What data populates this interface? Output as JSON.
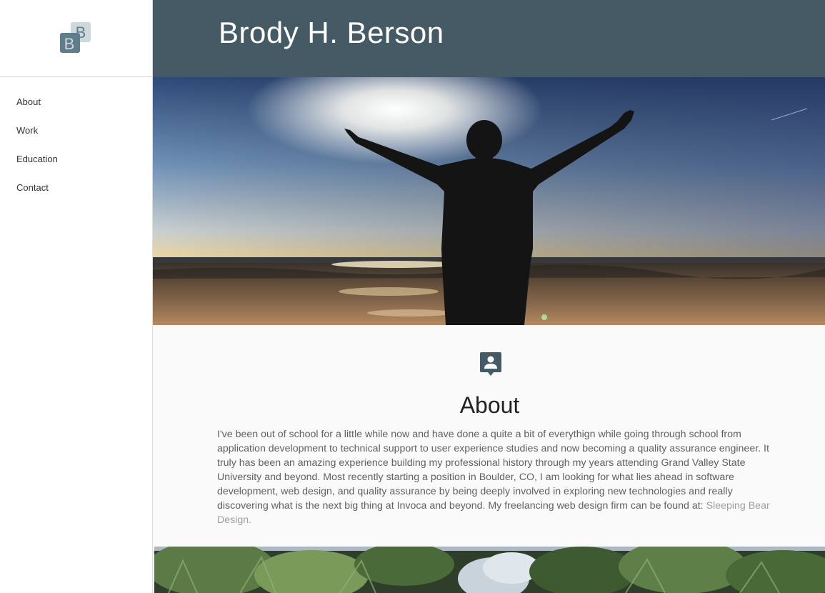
{
  "logo": {
    "letters": [
      "B",
      "B"
    ],
    "icon": "bb-monogram-logo"
  },
  "nav": {
    "items": [
      {
        "label": "About"
      },
      {
        "label": "Work"
      },
      {
        "label": "Education"
      },
      {
        "label": "Contact"
      }
    ]
  },
  "header": {
    "title": "Brody H. Berson"
  },
  "hero": {
    "icon": "hero-photo-person-arms-raised-beach"
  },
  "about": {
    "icon": "account-box-icon",
    "title": "About",
    "body": "I've been out of school for a little while now and have done a quite a bit of everythign while going through school from application development to technical support to user experience studies and now becoming a quality assurance engineer. It truly has been an amazing experience building my professional history through my years attending Grand Valley State University and beyond. Most recently starting a position in Boulder, CO, I am looking for what lies ahead in software development, web design, and quality assurance by being deeply involved in exploring new technologies and really discovering what is the next big thing at Invoca and beyond. My freelancing web design firm can be found at: ",
    "link_text": "Sleeping Bear Design."
  },
  "colors": {
    "header_bg": "#455a64",
    "logo_dark": "#607d8b",
    "logo_light": "#cfd8dc",
    "text": "#616161",
    "link": "#9e9e9e"
  }
}
